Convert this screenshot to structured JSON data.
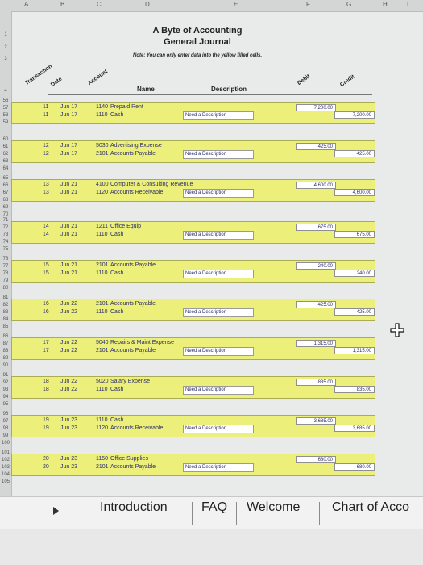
{
  "sheet": {
    "columns": [
      "A",
      "B",
      "C",
      "D",
      "E",
      "F",
      "G",
      "H",
      "I"
    ],
    "rows_top": [
      "1",
      "2",
      "3",
      "4"
    ],
    "title1": "A Byte of Accounting",
    "title2": "General Journal",
    "note": "Note: You can only enter data into the yellow filled cells.",
    "headers": {
      "transaction": "Transaction",
      "date": "Date",
      "account": "Account",
      "name": "Name",
      "description": "Description",
      "debit": "Debit",
      "credit": "Credit"
    }
  },
  "entries": [
    {
      "txn": "11",
      "date1": "Jun 17",
      "date2": "Jun 17",
      "acct1": "1140",
      "name1": "Prepaid Rent",
      "acct2": "1110",
      "name2": "Cash",
      "desc": "Need a Description",
      "debit": "7,200.00",
      "credit": "7,200.00",
      "rows": [
        "56",
        "57",
        "58",
        "59"
      ]
    },
    {
      "txn": "12",
      "date1": "Jun 17",
      "date2": "Jun 17",
      "acct1": "5030",
      "name1": "Advertising Expense",
      "acct2": "2101",
      "name2": "Accounts Payable",
      "desc": "Need a Description",
      "debit": "425.00",
      "credit": "425.00",
      "rows": [
        "60",
        "61",
        "62",
        "63",
        "64"
      ]
    },
    {
      "txn": "13",
      "date1": "Jun 21",
      "date2": "Jun 21",
      "acct1": "4100",
      "name1": "Computer & Consulting Revenue",
      "acct2": "1120",
      "name2": "Accounts Receivable",
      "desc": "Need a Description",
      "debit": "4,600.00",
      "credit": "4,600.00",
      "rows": [
        "65",
        "66",
        "67",
        "68",
        "69",
        "70"
      ]
    },
    {
      "txn": "14",
      "date1": "Jun 21",
      "date2": "Jun 21",
      "acct1": "1211",
      "name1": "Office Equip",
      "acct2": "1110",
      "name2": "Cash",
      "desc": "Need a Description",
      "debit": "675.00",
      "credit": "675.00",
      "rows": [
        "71",
        "72",
        "73",
        "74",
        "75"
      ]
    },
    {
      "txn": "15",
      "date1": "Jun 21",
      "date2": "Jun 21",
      "acct1": "2101",
      "name1": "Accounts Payable",
      "acct2": "1110",
      "name2": "Cash",
      "desc": "Need a Description",
      "debit": "240.00",
      "credit": "240.00",
      "rows": [
        "76",
        "77",
        "78",
        "79",
        "80"
      ]
    },
    {
      "txn": "16",
      "date1": "Jun 22",
      "date2": "Jun 22",
      "acct1": "2101",
      "name1": "Accounts Payable",
      "acct2": "1110",
      "name2": "Cash",
      "desc": "Need a Description",
      "debit": "425.00",
      "credit": "425.00",
      "rows": [
        "81",
        "82",
        "83",
        "84",
        "85"
      ]
    },
    {
      "txn": "17",
      "date1": "Jun 22",
      "date2": "Jun 22",
      "acct1": "5040",
      "name1": "Repairs & Maint Expense",
      "acct2": "2101",
      "name2": "Accounts Payable",
      "desc": "Need a Description",
      "debit": "1,315.00",
      "credit": "1,315.00",
      "rows": [
        "86",
        "87",
        "88",
        "89",
        "90"
      ]
    },
    {
      "txn": "18",
      "date1": "Jun 22",
      "date2": "Jun 22",
      "acct1": "5020",
      "name1": "Salary Expense",
      "acct2": "1110",
      "name2": "Cash",
      "desc": "Need a Description",
      "debit": "835.00",
      "credit": "835.00",
      "rows": [
        "91",
        "92",
        "93",
        "94",
        "95"
      ]
    },
    {
      "txn": "19",
      "date1": "Jun 23",
      "date2": "Jun 23",
      "acct1": "1110",
      "name1": "Cash",
      "acct2": "1120",
      "name2": "Accounts Receivable",
      "desc": "Need a Description",
      "debit": "3,685.00",
      "credit": "3,685.00",
      "rows": [
        "96",
        "97",
        "98",
        "99",
        "100"
      ]
    },
    {
      "txn": "20",
      "date1": "Jun 23",
      "date2": "Jun 23",
      "acct1": "1150",
      "name1": "Office Supplies",
      "acct2": "2101",
      "name2": "Accounts Payable",
      "desc": "Need a Description",
      "debit": "680.00",
      "credit": "680.00",
      "rows": [
        "101",
        "102",
        "103",
        "104",
        "105"
      ]
    }
  ],
  "tabs": [
    "Introduction",
    "FAQ",
    "Welcome",
    "Chart of Acco"
  ]
}
